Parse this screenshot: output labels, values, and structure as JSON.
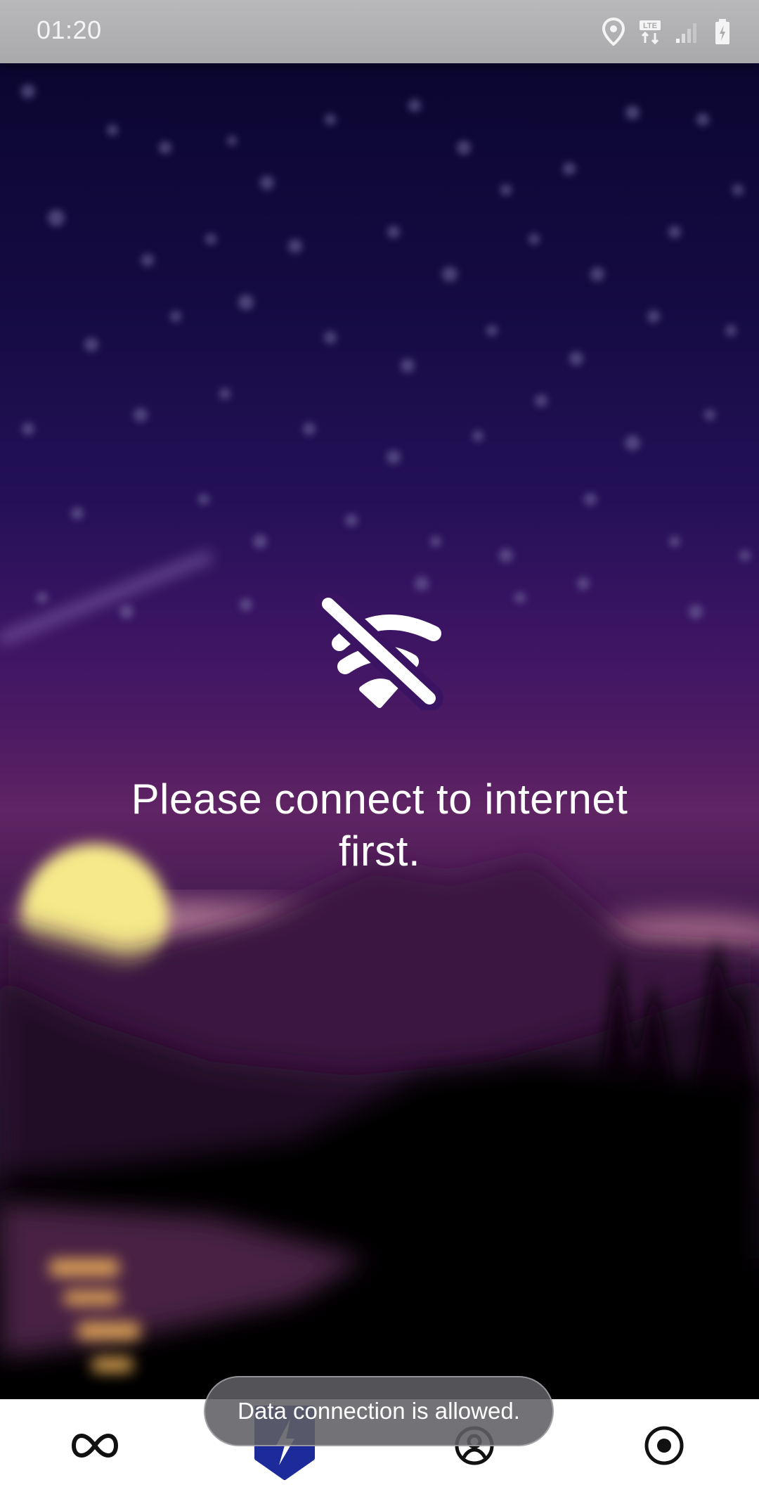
{
  "status_bar": {
    "time": "01:20",
    "icons": [
      "location-icon",
      "lte-icon",
      "signal-icon",
      "battery-charging-icon"
    ]
  },
  "main": {
    "icon": "wifi-off-icon",
    "message": "Please connect to internet first."
  },
  "toast": {
    "text": "Data connection is allowed."
  },
  "bottom_nav": {
    "items": [
      {
        "icon": "infinity-icon",
        "selected": false
      },
      {
        "icon": "lightning-icon",
        "selected": true
      },
      {
        "icon": "profile-icon",
        "selected": false
      },
      {
        "icon": "record-icon",
        "selected": false
      }
    ],
    "active_color": "#1d2a9a"
  },
  "colors": {
    "sky_top": "#0b0630",
    "sky_mid": "#3a1463",
    "horizon": "#5f2463",
    "sun": "#f6e98a",
    "status_bar": "#b0b0b3"
  }
}
